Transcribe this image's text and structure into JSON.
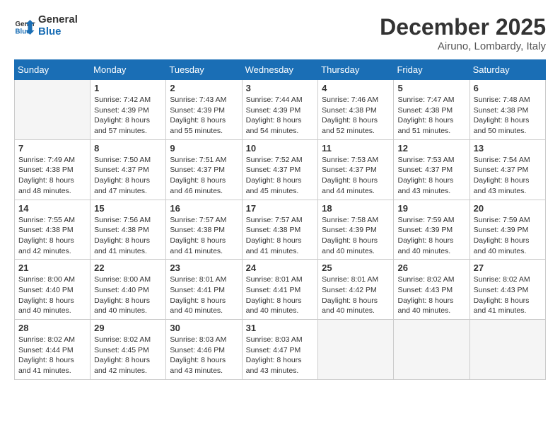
{
  "header": {
    "logo_line1": "General",
    "logo_line2": "Blue",
    "month": "December 2025",
    "location": "Airuno, Lombardy, Italy"
  },
  "weekdays": [
    "Sunday",
    "Monday",
    "Tuesday",
    "Wednesday",
    "Thursday",
    "Friday",
    "Saturday"
  ],
  "weeks": [
    [
      {
        "day": "",
        "empty": true
      },
      {
        "day": "1",
        "sunrise": "7:42 AM",
        "sunset": "4:39 PM",
        "daylight": "8 hours and 57 minutes."
      },
      {
        "day": "2",
        "sunrise": "7:43 AM",
        "sunset": "4:39 PM",
        "daylight": "8 hours and 55 minutes."
      },
      {
        "day": "3",
        "sunrise": "7:44 AM",
        "sunset": "4:39 PM",
        "daylight": "8 hours and 54 minutes."
      },
      {
        "day": "4",
        "sunrise": "7:46 AM",
        "sunset": "4:38 PM",
        "daylight": "8 hours and 52 minutes."
      },
      {
        "day": "5",
        "sunrise": "7:47 AM",
        "sunset": "4:38 PM",
        "daylight": "8 hours and 51 minutes."
      },
      {
        "day": "6",
        "sunrise": "7:48 AM",
        "sunset": "4:38 PM",
        "daylight": "8 hours and 50 minutes."
      }
    ],
    [
      {
        "day": "7",
        "sunrise": "7:49 AM",
        "sunset": "4:38 PM",
        "daylight": "8 hours and 48 minutes."
      },
      {
        "day": "8",
        "sunrise": "7:50 AM",
        "sunset": "4:37 PM",
        "daylight": "8 hours and 47 minutes."
      },
      {
        "day": "9",
        "sunrise": "7:51 AM",
        "sunset": "4:37 PM",
        "daylight": "8 hours and 46 minutes."
      },
      {
        "day": "10",
        "sunrise": "7:52 AM",
        "sunset": "4:37 PM",
        "daylight": "8 hours and 45 minutes."
      },
      {
        "day": "11",
        "sunrise": "7:53 AM",
        "sunset": "4:37 PM",
        "daylight": "8 hours and 44 minutes."
      },
      {
        "day": "12",
        "sunrise": "7:53 AM",
        "sunset": "4:37 PM",
        "daylight": "8 hours and 43 minutes."
      },
      {
        "day": "13",
        "sunrise": "7:54 AM",
        "sunset": "4:37 PM",
        "daylight": "8 hours and 43 minutes."
      }
    ],
    [
      {
        "day": "14",
        "sunrise": "7:55 AM",
        "sunset": "4:38 PM",
        "daylight": "8 hours and 42 minutes."
      },
      {
        "day": "15",
        "sunrise": "7:56 AM",
        "sunset": "4:38 PM",
        "daylight": "8 hours and 41 minutes."
      },
      {
        "day": "16",
        "sunrise": "7:57 AM",
        "sunset": "4:38 PM",
        "daylight": "8 hours and 41 minutes."
      },
      {
        "day": "17",
        "sunrise": "7:57 AM",
        "sunset": "4:38 PM",
        "daylight": "8 hours and 41 minutes."
      },
      {
        "day": "18",
        "sunrise": "7:58 AM",
        "sunset": "4:39 PM",
        "daylight": "8 hours and 40 minutes."
      },
      {
        "day": "19",
        "sunrise": "7:59 AM",
        "sunset": "4:39 PM",
        "daylight": "8 hours and 40 minutes."
      },
      {
        "day": "20",
        "sunrise": "7:59 AM",
        "sunset": "4:39 PM",
        "daylight": "8 hours and 40 minutes."
      }
    ],
    [
      {
        "day": "21",
        "sunrise": "8:00 AM",
        "sunset": "4:40 PM",
        "daylight": "8 hours and 40 minutes."
      },
      {
        "day": "22",
        "sunrise": "8:00 AM",
        "sunset": "4:40 PM",
        "daylight": "8 hours and 40 minutes."
      },
      {
        "day": "23",
        "sunrise": "8:01 AM",
        "sunset": "4:41 PM",
        "daylight": "8 hours and 40 minutes."
      },
      {
        "day": "24",
        "sunrise": "8:01 AM",
        "sunset": "4:41 PM",
        "daylight": "8 hours and 40 minutes."
      },
      {
        "day": "25",
        "sunrise": "8:01 AM",
        "sunset": "4:42 PM",
        "daylight": "8 hours and 40 minutes."
      },
      {
        "day": "26",
        "sunrise": "8:02 AM",
        "sunset": "4:43 PM",
        "daylight": "8 hours and 40 minutes."
      },
      {
        "day": "27",
        "sunrise": "8:02 AM",
        "sunset": "4:43 PM",
        "daylight": "8 hours and 41 minutes."
      }
    ],
    [
      {
        "day": "28",
        "sunrise": "8:02 AM",
        "sunset": "4:44 PM",
        "daylight": "8 hours and 41 minutes."
      },
      {
        "day": "29",
        "sunrise": "8:02 AM",
        "sunset": "4:45 PM",
        "daylight": "8 hours and 42 minutes."
      },
      {
        "day": "30",
        "sunrise": "8:03 AM",
        "sunset": "4:46 PM",
        "daylight": "8 hours and 43 minutes."
      },
      {
        "day": "31",
        "sunrise": "8:03 AM",
        "sunset": "4:47 PM",
        "daylight": "8 hours and 43 minutes."
      },
      {
        "day": "",
        "empty": true
      },
      {
        "day": "",
        "empty": true
      },
      {
        "day": "",
        "empty": true
      }
    ]
  ]
}
